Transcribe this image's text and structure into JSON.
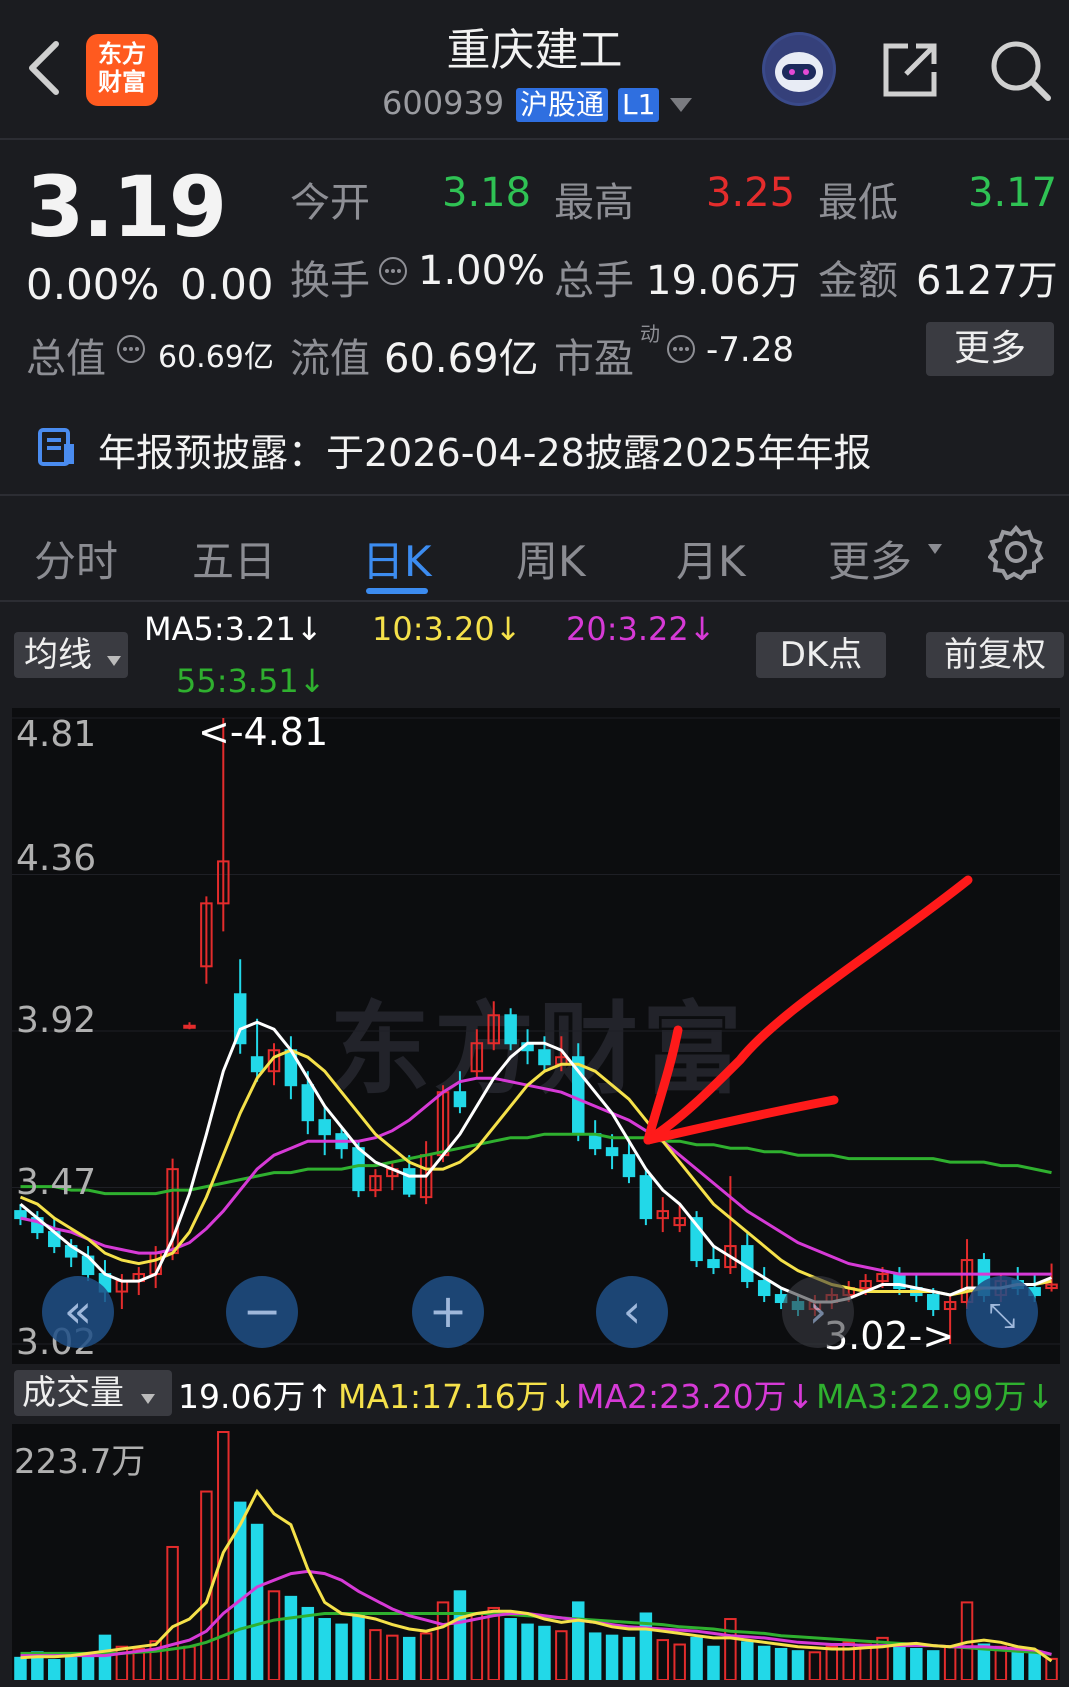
{
  "header": {
    "back_icon": "chevron-left-icon",
    "logo_line1": "东方",
    "logo_line2": "财富",
    "title": "重庆建工",
    "code": "600939",
    "tag1": "沪股通",
    "tag2": "L1",
    "share_icon": "share-icon",
    "search_icon": "search-icon"
  },
  "quote": {
    "price": "3.19",
    "change_pct": "0.00%",
    "change": "0.00",
    "open_label": "今开",
    "open": "3.18",
    "high_label": "最高",
    "high": "3.25",
    "low_label": "最低",
    "low": "3.17",
    "turnover_label": "换手",
    "turnover": "1.00%",
    "volume_label": "总手",
    "volume": "19.06万",
    "amount_label": "金额",
    "amount": "6127万",
    "mcap_label": "总值",
    "mcap": "60.69亿",
    "float_label": "流值",
    "float": "60.69亿",
    "pe_label": "市盈",
    "pe_sup": "动",
    "pe": "-7.28",
    "more": "更多"
  },
  "notice": {
    "text": "年报预披露：于2026-04-28披露2025年年报"
  },
  "tabs": [
    "分时",
    "五日",
    "日K",
    "周K",
    "月K",
    "更多"
  ],
  "ma_bar": {
    "button": "均线",
    "ma5": "MA5:3.21↓",
    "ma10": "10:3.20↓",
    "ma20": "20:3.22↓",
    "ma55": "55:3.51↓",
    "dk": "DK点",
    "fq": "前复权"
  },
  "price_axis": [
    "4.81",
    "4.36",
    "3.92",
    "3.47",
    "3.02"
  ],
  "price_marks": {
    "high": "<-4.81",
    "low": "3.02->"
  },
  "watermark": "东方财富",
  "vol_bar": {
    "button": "成交量",
    "vol": "19.06万↑",
    "ma1": "MA1:17.16万↓",
    "ma2": "MA2:23.20万↓",
    "ma3": "MA3:22.99万↓"
  },
  "vol_axis": "223.7万",
  "colors": {
    "up": "#e42c2c",
    "down": "#22d8e8",
    "ma5": "#ffffff",
    "ma10": "#f5e14a",
    "ma20": "#d63ad6",
    "ma55": "#2fb02f",
    "annotation": "#ff1a1a"
  },
  "chart_data": {
    "type": "candlestick",
    "ylim": [
      3.02,
      4.81
    ],
    "candles": [
      [
        3.4,
        3.42,
        3.36,
        3.38
      ],
      [
        3.38,
        3.4,
        3.32,
        3.34
      ],
      [
        3.34,
        3.38,
        3.28,
        3.3
      ],
      [
        3.3,
        3.32,
        3.24,
        3.27
      ],
      [
        3.27,
        3.3,
        3.2,
        3.22
      ],
      [
        3.22,
        3.26,
        3.14,
        3.17
      ],
      [
        3.17,
        3.22,
        3.12,
        3.2
      ],
      [
        3.2,
        3.24,
        3.16,
        3.22
      ],
      [
        3.22,
        3.3,
        3.18,
        3.28
      ],
      [
        3.28,
        3.55,
        3.26,
        3.52
      ],
      [
        3.93,
        3.94,
        3.92,
        3.93
      ],
      [
        4.1,
        4.3,
        4.05,
        4.28
      ],
      [
        4.28,
        4.81,
        4.2,
        4.4
      ],
      [
        4.02,
        4.12,
        3.85,
        3.88
      ],
      [
        3.84,
        3.95,
        3.77,
        3.8
      ],
      [
        3.8,
        3.88,
        3.76,
        3.86
      ],
      [
        3.86,
        3.9,
        3.72,
        3.76
      ],
      [
        3.76,
        3.8,
        3.62,
        3.66
      ],
      [
        3.66,
        3.7,
        3.56,
        3.62
      ],
      [
        3.62,
        3.64,
        3.55,
        3.58
      ],
      [
        3.58,
        3.6,
        3.44,
        3.46
      ],
      [
        3.46,
        3.52,
        3.44,
        3.5
      ],
      [
        3.5,
        3.54,
        3.46,
        3.52
      ],
      [
        3.52,
        3.56,
        3.44,
        3.45
      ],
      [
        3.44,
        3.6,
        3.42,
        3.56
      ],
      [
        3.56,
        3.76,
        3.54,
        3.74
      ],
      [
        3.74,
        3.8,
        3.68,
        3.7
      ],
      [
        3.8,
        3.92,
        3.78,
        3.88
      ],
      [
        3.88,
        4.0,
        3.86,
        3.96
      ],
      [
        3.96,
        3.98,
        3.86,
        3.88
      ],
      [
        3.88,
        3.92,
        3.82,
        3.86
      ],
      [
        3.86,
        3.9,
        3.8,
        3.82
      ],
      [
        3.82,
        3.9,
        3.8,
        3.84
      ],
      [
        3.84,
        3.88,
        3.6,
        3.62
      ],
      [
        3.62,
        3.66,
        3.56,
        3.58
      ],
      [
        3.58,
        3.62,
        3.52,
        3.56
      ],
      [
        3.56,
        3.6,
        3.48,
        3.5
      ],
      [
        3.5,
        3.52,
        3.36,
        3.38
      ],
      [
        3.38,
        3.44,
        3.34,
        3.4
      ],
      [
        3.36,
        3.42,
        3.34,
        3.38
      ],
      [
        3.38,
        3.4,
        3.24,
        3.26
      ],
      [
        3.26,
        3.3,
        3.22,
        3.24
      ],
      [
        3.24,
        3.5,
        3.22,
        3.3
      ],
      [
        3.3,
        3.34,
        3.18,
        3.2
      ],
      [
        3.2,
        3.24,
        3.14,
        3.16
      ],
      [
        3.16,
        3.18,
        3.12,
        3.14
      ],
      [
        3.14,
        3.16,
        3.1,
        3.12
      ],
      [
        3.12,
        3.16,
        3.1,
        3.14
      ],
      [
        3.14,
        3.18,
        3.12,
        3.16
      ],
      [
        3.16,
        3.2,
        3.14,
        3.18
      ],
      [
        3.18,
        3.22,
        3.16,
        3.2
      ],
      [
        3.2,
        3.24,
        3.18,
        3.22
      ],
      [
        3.22,
        3.24,
        3.16,
        3.18
      ],
      [
        3.18,
        3.22,
        3.14,
        3.16
      ],
      [
        3.16,
        3.18,
        3.1,
        3.12
      ],
      [
        3.12,
        3.16,
        3.02,
        3.14
      ],
      [
        3.14,
        3.32,
        3.12,
        3.26
      ],
      [
        3.26,
        3.28,
        3.14,
        3.16
      ],
      [
        3.16,
        3.22,
        3.14,
        3.2
      ],
      [
        3.2,
        3.24,
        3.16,
        3.18
      ],
      [
        3.18,
        3.22,
        3.14,
        3.16
      ],
      [
        3.18,
        3.25,
        3.17,
        3.19
      ]
    ],
    "ma5": [
      3.42,
      3.38,
      3.34,
      3.3,
      3.27,
      3.22,
      3.2,
      3.2,
      3.22,
      3.32,
      3.45,
      3.62,
      3.8,
      3.92,
      3.94,
      3.92,
      3.86,
      3.78,
      3.7,
      3.64,
      3.58,
      3.54,
      3.52,
      3.5,
      3.5,
      3.56,
      3.62,
      3.7,
      3.78,
      3.84,
      3.88,
      3.88,
      3.86,
      3.8,
      3.74,
      3.68,
      3.6,
      3.52,
      3.46,
      3.42,
      3.36,
      3.3,
      3.27,
      3.24,
      3.21,
      3.18,
      3.16,
      3.14,
      3.14,
      3.15,
      3.17,
      3.19,
      3.19,
      3.18,
      3.17,
      3.16,
      3.18,
      3.18,
      3.18,
      3.19,
      3.19,
      3.21
    ],
    "ma10": [
      3.44,
      3.42,
      3.38,
      3.35,
      3.32,
      3.28,
      3.26,
      3.25,
      3.26,
      3.28,
      3.34,
      3.44,
      3.56,
      3.68,
      3.78,
      3.84,
      3.86,
      3.84,
      3.8,
      3.74,
      3.68,
      3.62,
      3.58,
      3.54,
      3.52,
      3.52,
      3.54,
      3.58,
      3.64,
      3.7,
      3.76,
      3.8,
      3.82,
      3.82,
      3.8,
      3.76,
      3.72,
      3.66,
      3.6,
      3.54,
      3.48,
      3.42,
      3.38,
      3.34,
      3.3,
      3.26,
      3.23,
      3.21,
      3.19,
      3.18,
      3.17,
      3.17,
      3.17,
      3.17,
      3.17,
      3.16,
      3.17,
      3.18,
      3.18,
      3.19,
      3.19,
      3.2
    ],
    "ma20": [
      3.38,
      3.37,
      3.35,
      3.34,
      3.32,
      3.3,
      3.29,
      3.28,
      3.28,
      3.29,
      3.31,
      3.35,
      3.4,
      3.46,
      3.52,
      3.56,
      3.58,
      3.6,
      3.6,
      3.6,
      3.6,
      3.61,
      3.63,
      3.66,
      3.7,
      3.74,
      3.77,
      3.78,
      3.78,
      3.77,
      3.76,
      3.75,
      3.74,
      3.72,
      3.7,
      3.68,
      3.66,
      3.63,
      3.6,
      3.56,
      3.52,
      3.48,
      3.44,
      3.4,
      3.37,
      3.34,
      3.31,
      3.29,
      3.27,
      3.25,
      3.24,
      3.23,
      3.22,
      3.22,
      3.22,
      3.22,
      3.22,
      3.22,
      3.22,
      3.22,
      3.22,
      3.22
    ],
    "ma55": [
      3.47,
      3.47,
      3.47,
      3.46,
      3.46,
      3.45,
      3.45,
      3.45,
      3.45,
      3.46,
      3.46,
      3.47,
      3.48,
      3.49,
      3.5,
      3.51,
      3.51,
      3.52,
      3.52,
      3.52,
      3.53,
      3.53,
      3.54,
      3.55,
      3.56,
      3.57,
      3.58,
      3.59,
      3.6,
      3.61,
      3.61,
      3.62,
      3.62,
      3.62,
      3.62,
      3.61,
      3.61,
      3.61,
      3.6,
      3.6,
      3.59,
      3.59,
      3.58,
      3.58,
      3.57,
      3.57,
      3.56,
      3.56,
      3.56,
      3.55,
      3.55,
      3.55,
      3.55,
      3.55,
      3.55,
      3.54,
      3.54,
      3.54,
      3.53,
      3.53,
      3.52,
      3.51
    ],
    "volume": [
      20,
      25,
      18,
      22,
      24,
      40,
      30,
      28,
      35,
      120,
      30,
      170,
      223.7,
      160,
      140,
      80,
      75,
      65,
      55,
      50,
      60,
      45,
      40,
      38,
      42,
      70,
      80,
      60,
      65,
      55,
      50,
      48,
      44,
      70,
      42,
      40,
      38,
      60,
      36,
      32,
      38,
      30,
      55,
      34,
      30,
      28,
      26,
      25,
      30,
      34,
      32,
      38,
      30,
      28,
      26,
      30,
      70,
      32,
      30,
      28,
      26,
      19.06
    ],
    "vol_ma1": [
      20,
      21,
      21,
      22,
      24,
      26,
      28,
      30,
      32,
      48,
      55,
      70,
      115,
      140,
      170,
      150,
      140,
      100,
      70,
      60,
      58,
      55,
      50,
      46,
      44,
      48,
      56,
      60,
      62,
      62,
      60,
      55,
      52,
      54,
      52,
      48,
      46,
      46,
      44,
      42,
      40,
      38,
      38,
      36,
      34,
      32,
      30,
      29,
      28,
      28,
      29,
      30,
      32,
      33,
      31,
      30,
      34,
      36,
      34,
      30,
      28,
      17.16
    ],
    "vol_ma2": [
      22,
      22,
      22,
      22,
      22,
      22,
      24,
      26,
      28,
      32,
      36,
      44,
      60,
      72,
      84,
      90,
      96,
      98,
      96,
      90,
      80,
      72,
      64,
      58,
      54,
      50,
      52,
      55,
      58,
      60,
      60,
      58,
      56,
      54,
      52,
      50,
      48,
      47,
      46,
      45,
      44,
      42,
      40,
      39,
      38,
      36,
      34,
      33,
      32,
      32,
      31,
      31,
      31,
      31,
      31,
      30,
      30,
      30,
      29,
      28,
      27,
      23.2
    ],
    "vol_ma3": [
      24,
      24,
      24,
      24,
      24,
      24,
      24,
      25,
      26,
      28,
      30,
      34,
      40,
      46,
      50,
      54,
      56,
      58,
      60,
      60,
      60,
      60,
      60,
      60,
      60,
      60,
      60,
      60,
      60,
      59,
      58,
      57,
      56,
      55,
      54,
      53,
      52,
      51,
      50,
      48,
      47,
      46,
      44,
      43,
      42,
      40,
      39,
      38,
      37,
      36,
      35,
      34,
      33,
      32,
      31,
      30,
      29,
      28,
      27,
      26,
      25,
      22.99
    ]
  }
}
